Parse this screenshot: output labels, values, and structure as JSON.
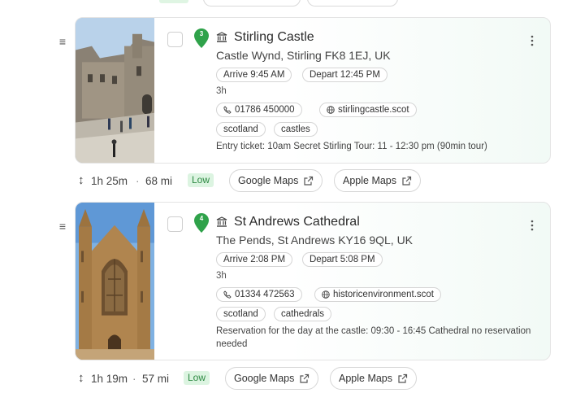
{
  "stops": [
    {
      "number": "3",
      "title": "Stirling Castle",
      "address": "Castle Wynd, Stirling FK8 1EJ, UK",
      "arrive": "Arrive 9:45 AM",
      "depart": "Depart 12:45 PM",
      "duration": "3h",
      "phone": "01786 450000",
      "website": "stirlingcastle.scot",
      "tags": [
        "scotland",
        "castles"
      ],
      "note": "Entry ticket: 10am Secret Stirling Tour: 11 - 12:30 pm (90min tour)",
      "type_icon": "museum-icon"
    },
    {
      "number": "4",
      "title": "St Andrews Cathedral",
      "address": "The Pends, St Andrews KY16 9QL, UK",
      "arrive": "Arrive 2:08 PM",
      "depart": "Depart 5:08 PM",
      "duration": "3h",
      "phone": "01334 472563",
      "website": "historicenvironment.scot",
      "tags": [
        "scotland",
        "cathedrals"
      ],
      "note": "Reservation for the day at the castle: 09:30 - 16:45 Cathedral no reservation needed",
      "type_icon": "museum-icon"
    }
  ],
  "travel": [
    {
      "time": "1h 25m",
      "separator": "·",
      "distance": "68 mi",
      "traffic": "Low",
      "google": "Google Maps",
      "apple": "Apple Maps"
    },
    {
      "time": "1h 19m",
      "separator": "·",
      "distance": "57 mi",
      "traffic": "Low",
      "google": "Google Maps",
      "apple": "Apple Maps"
    }
  ],
  "colors": {
    "pin": "#2fa24a",
    "badge_bg": "#dcf4e1",
    "badge_text": "#2e8a43",
    "border": "#e4e4e4"
  }
}
